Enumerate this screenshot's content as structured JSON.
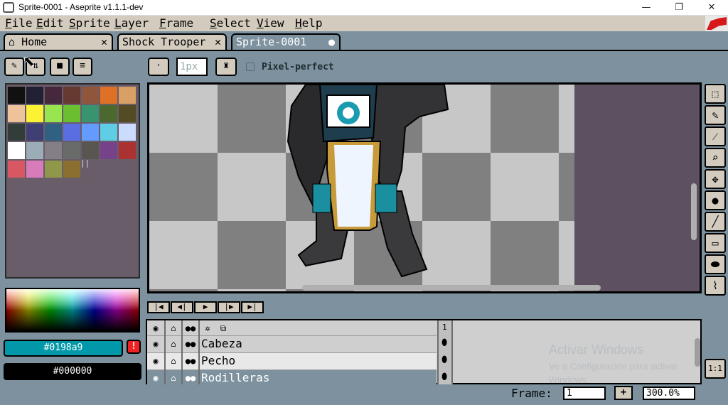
{
  "window": {
    "title": "Sprite-0001 - Aseprite v1.1.1-dev",
    "minimize": "—",
    "maximize": "❐",
    "close": "✕"
  },
  "menu": [
    "File",
    "Edit",
    "Sprite",
    "Layer",
    "Frame",
    "Select",
    "View",
    "Help"
  ],
  "tabs": [
    {
      "label": "Home",
      "close": "✕",
      "icon": "home-icon"
    },
    {
      "label": "Shock Trooper",
      "close": "✕"
    },
    {
      "label": "Sprite-0001",
      "close": "●"
    }
  ],
  "toolbar": {
    "brush_size": "1px",
    "pixel_perfect_label": "Pixel-perfect"
  },
  "palette": {
    "colors": [
      "#111111",
      "#222034",
      "#45283c",
      "#663931",
      "#8f563b",
      "#df7126",
      "#d9a066",
      "#eec39a",
      "#fbf236",
      "#99e550",
      "#6abe30",
      "#37946e",
      "#4b692f",
      "#524b24",
      "#323c39",
      "#3f3f74",
      "#306082",
      "#5b6ee1",
      "#639bff",
      "#5fcde4",
      "#cbdbfc",
      "#ffffff",
      "#9badb7",
      "#847e87",
      "#696a6a",
      "#595652",
      "#76428a",
      "#ac3232",
      "#d95763",
      "#d77bba",
      "#8f974a",
      "#8a6f30"
    ],
    "pause_glyph": "||"
  },
  "colors": {
    "foreground": "#0198a9",
    "background": "#000000",
    "warning": "!"
  },
  "layers": [
    {
      "name": "Cabeza"
    },
    {
      "name": "Pecho"
    },
    {
      "name": "Rodilleras"
    }
  ],
  "timeline": {
    "frame_header": "1"
  },
  "status": {
    "frame_label": "Frame:",
    "frame_value": "1",
    "plus": "+",
    "zoom": "300.0%",
    "one_to_one": "1:1"
  },
  "watermark": {
    "line1": "Activar Windows",
    "line2": "Ve a Configuración para activar",
    "line3": "Windows."
  }
}
